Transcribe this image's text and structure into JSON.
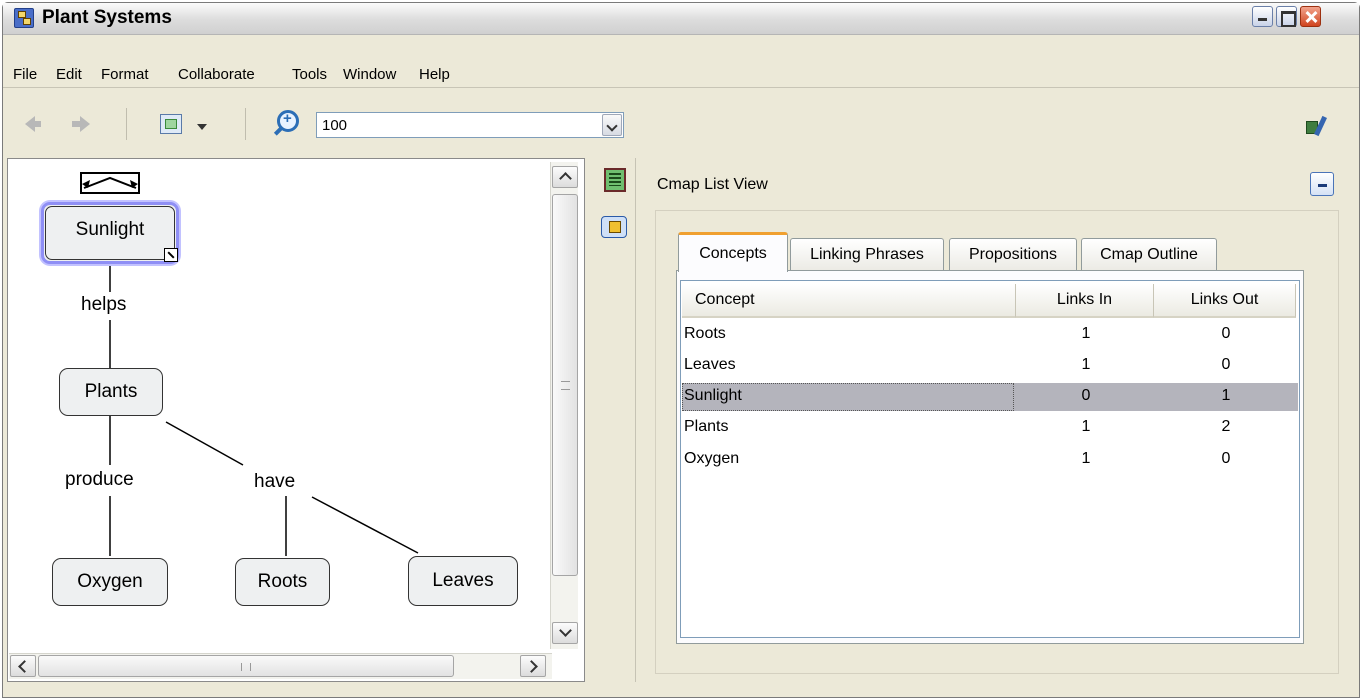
{
  "window": {
    "title": "Plant Systems"
  },
  "menu": [
    "File",
    "Edit",
    "Format",
    "Collaborate",
    "Tools",
    "Window",
    "Help"
  ],
  "toolbar": {
    "zoom_value": "100"
  },
  "cmap": {
    "concepts": {
      "sunlight": "Sunlight",
      "plants": "Plants",
      "oxygen": "Oxygen",
      "roots": "Roots",
      "leaves": "Leaves"
    },
    "linking_phrases": {
      "helps": "helps",
      "produce": "produce",
      "have": "have"
    }
  },
  "side_panel": {
    "title": "Cmap List View",
    "tabs": [
      "Concepts",
      "Linking Phrases",
      "Propositions",
      "Cmap Outline"
    ],
    "active_tab": "Concepts",
    "table": {
      "columns": [
        "Concept",
        "Links In",
        "Links Out"
      ],
      "rows": [
        {
          "concept": "Roots",
          "links_in": "1",
          "links_out": "0"
        },
        {
          "concept": "Leaves",
          "links_in": "1",
          "links_out": "0"
        },
        {
          "concept": "Sunlight",
          "links_in": "0",
          "links_out": "1"
        },
        {
          "concept": "Plants",
          "links_in": "1",
          "links_out": "2"
        },
        {
          "concept": "Oxygen",
          "links_in": "1",
          "links_out": "0"
        }
      ],
      "selected_row": "Sunlight"
    }
  },
  "colors": {
    "selection_highlight": "#b4b4bc",
    "concept_fill": "#eef0f1",
    "selected_concept_border": "#8f8ff5",
    "active_tab_accent": "#f0a030"
  }
}
